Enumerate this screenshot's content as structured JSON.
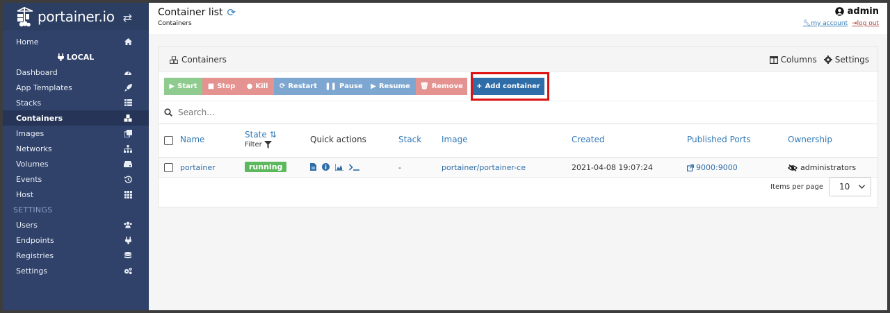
{
  "brand": {
    "name": "portainer.io"
  },
  "sidebar": {
    "items_top": [
      {
        "label": "Home",
        "icon": "home-icon"
      }
    ],
    "local_label": "LOCAL",
    "items": [
      {
        "label": "Dashboard",
        "icon": "dashboard-icon"
      },
      {
        "label": "App Templates",
        "icon": "rocket-icon"
      },
      {
        "label": "Stacks",
        "icon": "list-icon"
      },
      {
        "label": "Containers",
        "icon": "cubes-icon",
        "active": true
      },
      {
        "label": "Images",
        "icon": "clone-icon"
      },
      {
        "label": "Networks",
        "icon": "sitemap-icon"
      },
      {
        "label": "Volumes",
        "icon": "hdd-icon"
      },
      {
        "label": "Events",
        "icon": "history-icon"
      },
      {
        "label": "Host",
        "icon": "grid-icon"
      }
    ],
    "settings_heading": "SETTINGS",
    "settings_items": [
      {
        "label": "Users",
        "icon": "users-icon"
      },
      {
        "label": "Endpoints",
        "icon": "plug-icon"
      },
      {
        "label": "Registries",
        "icon": "database-icon"
      },
      {
        "label": "Settings",
        "icon": "cogs-icon"
      }
    ]
  },
  "header": {
    "title": "Container list",
    "breadcrumb": "Containers",
    "user": "admin",
    "my_account": "my account",
    "log_out": "log out"
  },
  "panel": {
    "title": "Containers",
    "columns_label": "Columns",
    "settings_label": "Settings"
  },
  "actions": {
    "start": "Start",
    "stop": "Stop",
    "kill": "Kill",
    "restart": "Restart",
    "pause": "Pause",
    "resume": "Resume",
    "remove": "Remove",
    "add": "Add container"
  },
  "search": {
    "placeholder": "Search..."
  },
  "table": {
    "headers": {
      "name": "Name",
      "state": "State",
      "filter": "Filter",
      "quick_actions": "Quick actions",
      "stack": "Stack",
      "image": "Image",
      "created": "Created",
      "ports": "Published Ports",
      "ownership": "Ownership"
    },
    "rows": [
      {
        "name": "portainer",
        "state": "running",
        "stack": "-",
        "image": "portainer/portainer-ce",
        "created": "2021-04-08 19:07:24",
        "ports": "9000:9000",
        "ownership": "administrators"
      }
    ]
  },
  "pagination": {
    "label": "Items per page",
    "value": "10"
  },
  "colors": {
    "sidebar": "#30426a",
    "accent": "#337ab7",
    "success": "#5cb85c",
    "danger": "#e59390",
    "highlight": "#e01010"
  }
}
